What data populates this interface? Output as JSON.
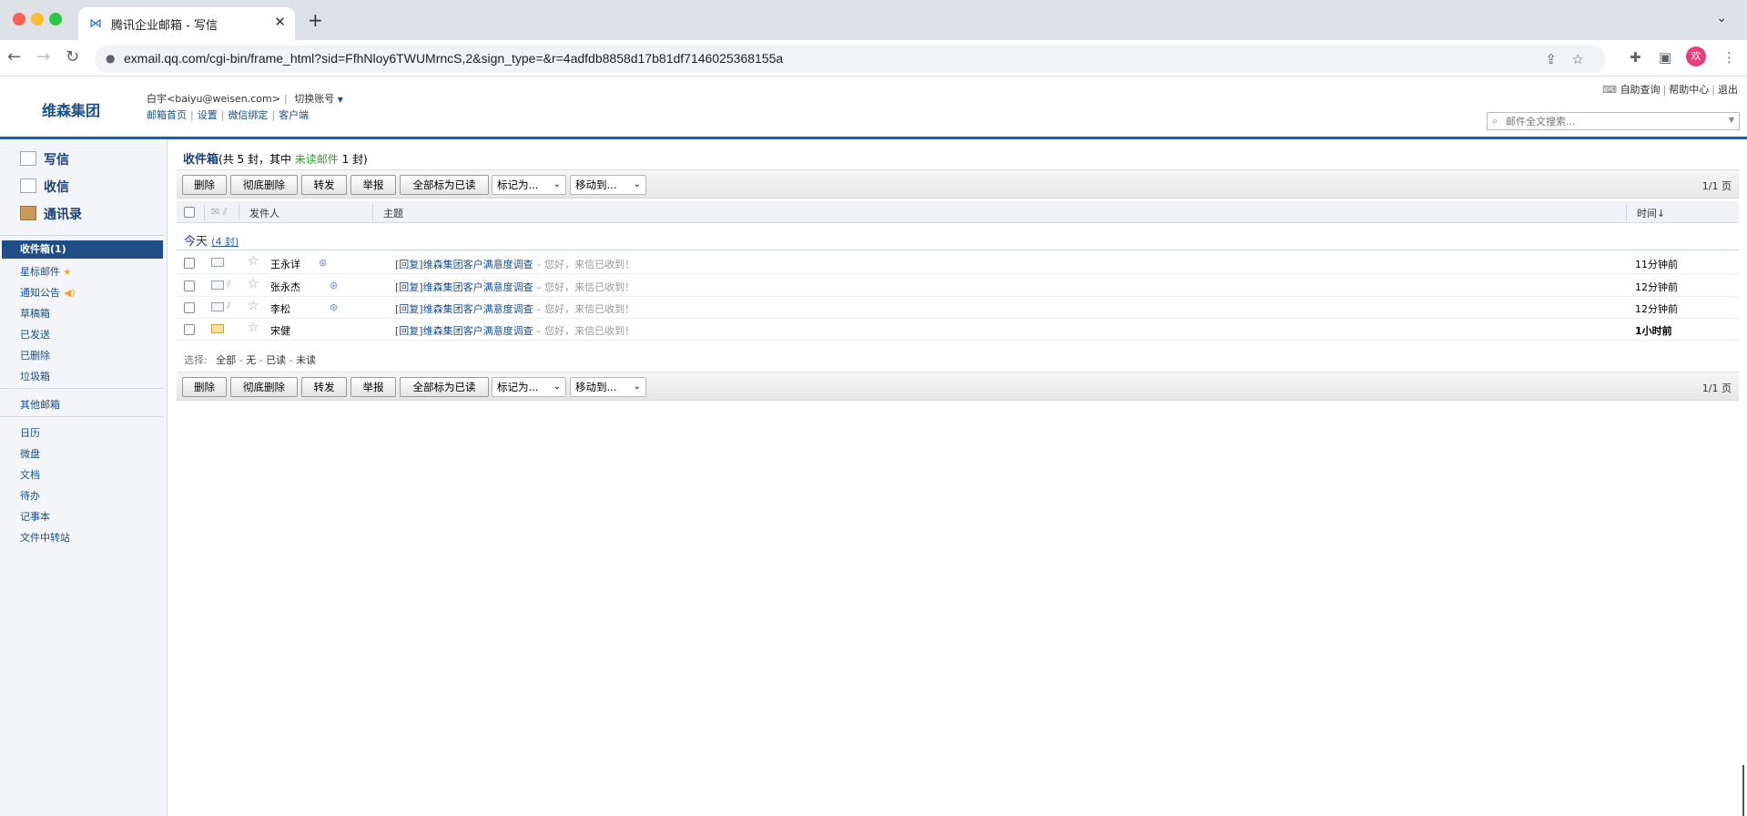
{
  "browser": {
    "tab_title": "腾讯企业邮箱 - 写信",
    "url": "exmail.qq.com/cgi-bin/frame_html?sid=FfhNloy6TWUMrncS,2&sign_type=&r=4adfdb8858d17b81df7146025368155a",
    "avatar_text": "欢"
  },
  "header": {
    "brand": "维森集团",
    "user": "白宇<baiyu@weisen.com>",
    "switch_account": "切换账号",
    "links": [
      "邮箱首页",
      "设置",
      "微信绑定",
      "客户端"
    ],
    "top_links": [
      "自助查询",
      "帮助中心",
      "退出"
    ],
    "search_placeholder": "邮件全文搜索..."
  },
  "sidebar": {
    "actions": [
      "写信",
      "收信",
      "通讯录"
    ],
    "folders": [
      "收件箱(1)",
      "星标邮件",
      "通知公告",
      "草稿箱",
      "已发送",
      "已删除",
      "垃圾箱"
    ],
    "other": "其他邮箱",
    "apps": [
      "日历",
      "微盘",
      "文档",
      "待办",
      "记事本",
      "文件中转站"
    ]
  },
  "inbox": {
    "title": "收件箱",
    "summary_prefix": "(共 5 封，其中 ",
    "unread_label": "未读邮件",
    "summary_suffix": " 1 封)",
    "buttons": [
      "删除",
      "彻底删除",
      "转发",
      "举报",
      "全部标为已读"
    ],
    "mark_as": "标记为...",
    "move_to": "移动到...",
    "pager": "1/1 页",
    "columns": {
      "sender": "发件人",
      "subject": "主题",
      "time": "时间↓"
    },
    "group": {
      "label": "今天",
      "count": "(4 封)"
    },
    "rows": [
      {
        "sender": "王永详",
        "subject": "[回复]维森集团客户满意度调查",
        "digest": " – 您好，来信已收到！",
        "time": "11分钟前"
      },
      {
        "sender": "张永杰",
        "subject": "[回复]维森集团客户满意度调查",
        "digest": " – 您好，来信已收到！",
        "time": "12分钟前"
      },
      {
        "sender": "李松",
        "subject": "[回复]维森集团客户满意度调查",
        "digest": " – 您好，来信已收到！",
        "time": "12分钟前"
      },
      {
        "sender": "宋健",
        "subject": "[回复]维森集团客户满意度调查",
        "digest": " – 您好，来信已收到！",
        "time": "1小时前"
      }
    ],
    "select": {
      "label": "选择:",
      "options": [
        "全部",
        "无",
        "已读",
        "未读"
      ]
    }
  }
}
